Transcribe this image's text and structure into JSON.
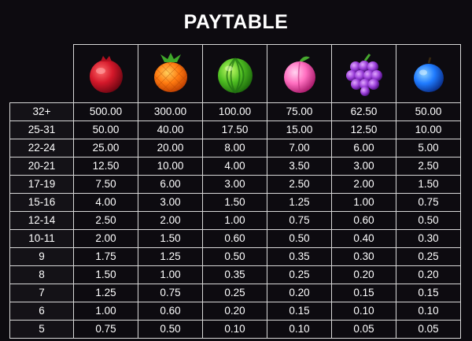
{
  "title": "PAYTABLE",
  "symbols": [
    {
      "icon": "pomegranate-icon",
      "color": "#d4182a"
    },
    {
      "icon": "pineapple-icon",
      "color": "#ff7a10"
    },
    {
      "icon": "watermelon-icon",
      "color": "#4fbf22"
    },
    {
      "icon": "peach-icon",
      "color": "#ff6fc0"
    },
    {
      "icon": "grapes-icon",
      "color": "#9a3fd8"
    },
    {
      "icon": "plum-icon",
      "color": "#1f7bff"
    }
  ],
  "rows": [
    {
      "count": "32+",
      "values": [
        "500.00",
        "300.00",
        "100.00",
        "75.00",
        "62.50",
        "50.00"
      ]
    },
    {
      "count": "25-31",
      "values": [
        "50.00",
        "40.00",
        "17.50",
        "15.00",
        "12.50",
        "10.00"
      ]
    },
    {
      "count": "22-24",
      "values": [
        "25.00",
        "20.00",
        "8.00",
        "7.00",
        "6.00",
        "5.00"
      ]
    },
    {
      "count": "20-21",
      "values": [
        "12.50",
        "10.00",
        "4.00",
        "3.50",
        "3.00",
        "2.50"
      ]
    },
    {
      "count": "17-19",
      "values": [
        "7.50",
        "6.00",
        "3.00",
        "2.50",
        "2.00",
        "1.50"
      ]
    },
    {
      "count": "15-16",
      "values": [
        "4.00",
        "3.00",
        "1.50",
        "1.25",
        "1.00",
        "0.75"
      ]
    },
    {
      "count": "12-14",
      "values": [
        "2.50",
        "2.00",
        "1.00",
        "0.75",
        "0.60",
        "0.50"
      ]
    },
    {
      "count": "10-11",
      "values": [
        "2.00",
        "1.50",
        "0.60",
        "0.50",
        "0.40",
        "0.30"
      ]
    },
    {
      "count": "9",
      "values": [
        "1.75",
        "1.25",
        "0.50",
        "0.35",
        "0.30",
        "0.25"
      ]
    },
    {
      "count": "8",
      "values": [
        "1.50",
        "1.00",
        "0.35",
        "0.25",
        "0.20",
        "0.20"
      ]
    },
    {
      "count": "7",
      "values": [
        "1.25",
        "0.75",
        "0.25",
        "0.20",
        "0.15",
        "0.15"
      ]
    },
    {
      "count": "6",
      "values": [
        "1.00",
        "0.60",
        "0.20",
        "0.15",
        "0.10",
        "0.10"
      ]
    },
    {
      "count": "5",
      "values": [
        "0.75",
        "0.50",
        "0.10",
        "0.10",
        "0.05",
        "0.05"
      ]
    }
  ]
}
